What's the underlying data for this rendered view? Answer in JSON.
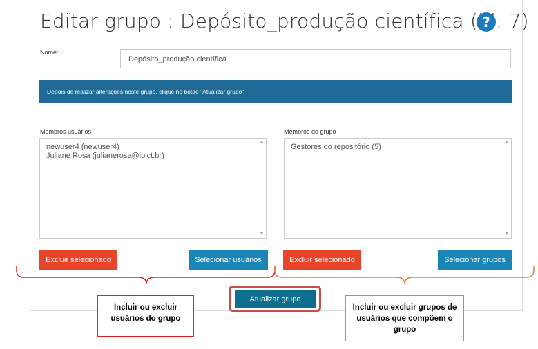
{
  "page": {
    "title": "Editar grupo : Depósito_produção científica (id: 7)",
    "help_icon": "?"
  },
  "form": {
    "name_label": "Nome:",
    "name_value": "Depósito_produção científica",
    "banner_text": "Depois de realizar alterações neste grupo, clique no botão \"Atualizar grupo\""
  },
  "users_panel": {
    "label": "Membros usuários",
    "items": [
      "newuser4 (newuser4)",
      "Juliane Rosa (julianerosa@ibict.br)"
    ],
    "remove_button": "Excluir selecionado",
    "select_button": "Selecionar usuários"
  },
  "groups_panel": {
    "label": "Membros do grupo",
    "items": [
      "Gestores do repositório (5)"
    ],
    "remove_button": "Excluir selecionado",
    "select_button": "Selecionar grupos"
  },
  "update_button": "Atualizar grupo",
  "annotations": {
    "left_callout": "Incluir ou excluir usuários do grupo",
    "right_callout": "Incluir ou excluir grupos de usuários que compõem o grupo"
  },
  "colors": {
    "brace_left": "#e02020",
    "brace_right": "#ed7d31",
    "update_highlight": "#c0504d"
  }
}
